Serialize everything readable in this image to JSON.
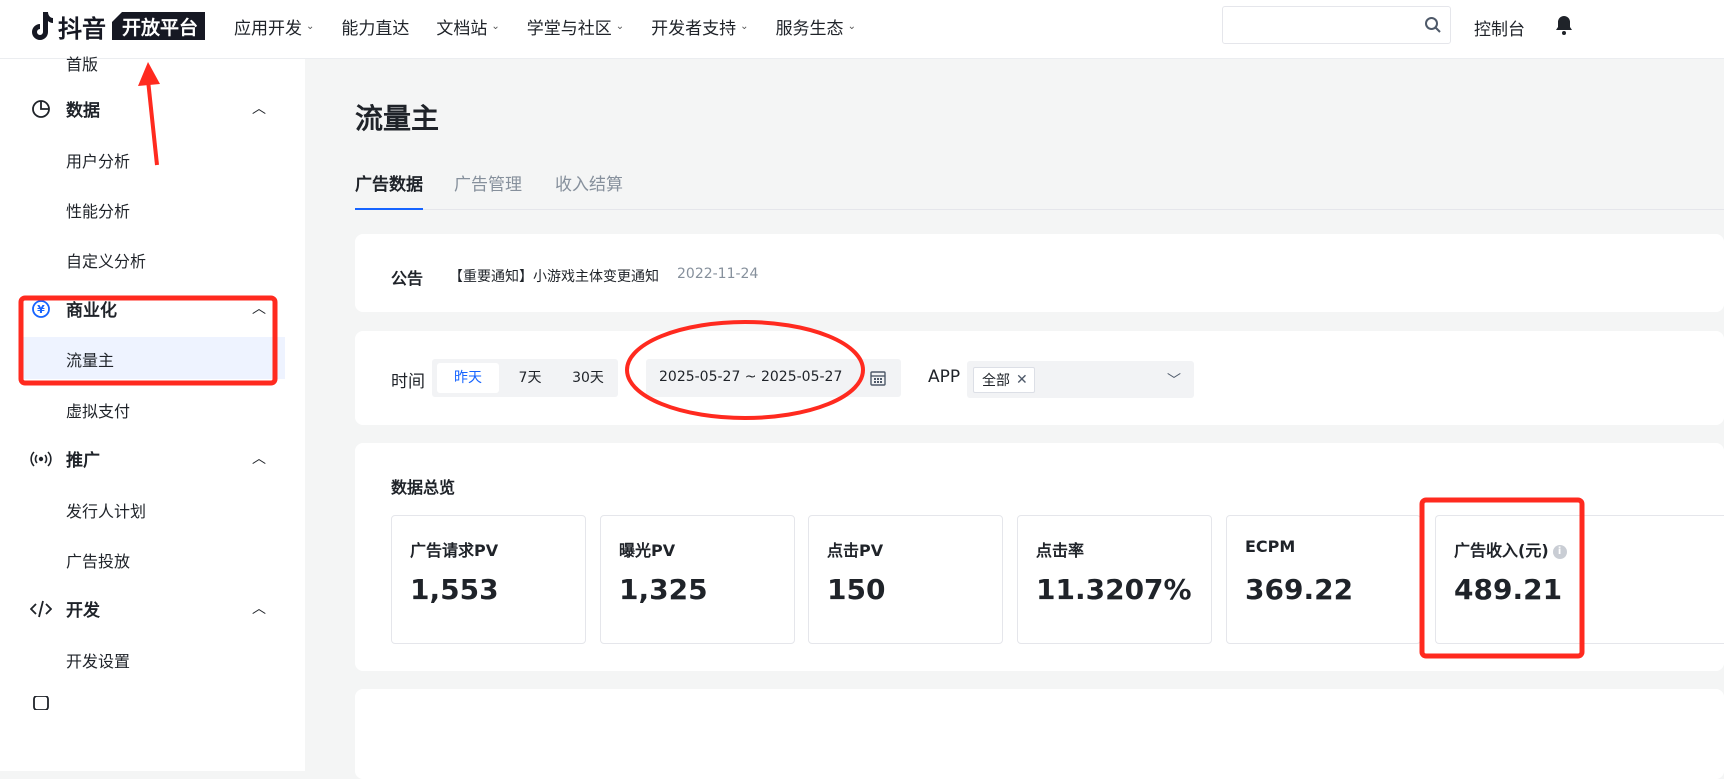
{
  "header": {
    "logo_text": "抖音",
    "logo_badge": "开放平台",
    "nav": [
      {
        "label": "应用开发",
        "has_menu": true
      },
      {
        "label": "能力直达",
        "has_menu": false
      },
      {
        "label": "文档站",
        "has_menu": true
      },
      {
        "label": "学堂与社区",
        "has_menu": true
      },
      {
        "label": "开发者支持",
        "has_menu": true
      },
      {
        "label": "服务生态",
        "has_menu": true
      }
    ],
    "search_placeholder": "",
    "console_label": "控制台"
  },
  "sidebar": {
    "partial_item": "首版",
    "groups": [
      {
        "label": "数据",
        "icon": "pie-chart-icon",
        "items": [
          "用户分析",
          "性能分析",
          "自定义分析"
        ]
      },
      {
        "label": "商业化",
        "icon": "yuan-coin-icon",
        "items": [
          "流量主",
          "虚拟支付"
        ]
      },
      {
        "label": "推广",
        "icon": "broadcast-icon",
        "items": [
          "发行人计划",
          "广告投放"
        ]
      },
      {
        "label": "开发",
        "icon": "code-icon",
        "items": [
          "开发设置"
        ]
      }
    ],
    "active_item": "流量主"
  },
  "page": {
    "title": "流量主",
    "tabs": [
      {
        "label": "广告数据",
        "active": true
      },
      {
        "label": "广告管理",
        "active": false
      },
      {
        "label": "收入结算",
        "active": false
      }
    ]
  },
  "notice": {
    "label": "公告",
    "text": "【重要通知】小游戏主体变更通知",
    "date": "2022-11-24"
  },
  "filters": {
    "time_label": "时间",
    "presets": [
      {
        "label": "昨天",
        "selected": true
      },
      {
        "label": "7天",
        "selected": false
      },
      {
        "label": "30天",
        "selected": false
      }
    ],
    "date_range": "2025-05-27 ~ 2025-05-27",
    "app_label": "APP",
    "app_tag": "全部"
  },
  "overview": {
    "title": "数据总览",
    "metrics": [
      {
        "label": "广告请求PV",
        "value": "1,553"
      },
      {
        "label": "曝光PV",
        "value": "1,325"
      },
      {
        "label": "点击PV",
        "value": "150"
      },
      {
        "label": "点击率",
        "value": "11.3207%"
      },
      {
        "label": "ECPM",
        "value": "369.22"
      },
      {
        "label": "广告收入(元)",
        "value": "489.21",
        "has_info": true
      }
    ]
  },
  "colors": {
    "accent": "#1664ff",
    "annotation": "#ff2a1f",
    "active_bg": "#eef3ff"
  }
}
